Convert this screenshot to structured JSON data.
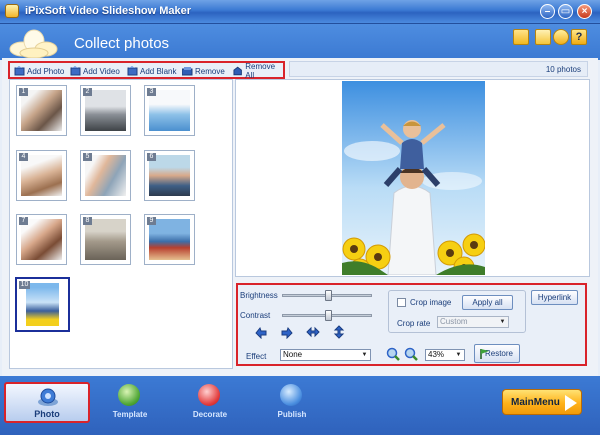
{
  "window": {
    "title": "iPixSoft Video Slideshow Maker"
  },
  "header": {
    "title": "Collect photos"
  },
  "toolbar": {
    "add_photo": "Add Photo",
    "add_video": "Add Video",
    "add_blank": "Add Blank",
    "remove": "Remove",
    "remove_all": "Remove All"
  },
  "photo_count": "10 photos",
  "thumbnails": [
    "1",
    "2",
    "3",
    "4",
    "5",
    "6",
    "7",
    "8",
    "9",
    "10"
  ],
  "selected_thumbnail": "10",
  "controls": {
    "brightness_label": "Brightness",
    "brightness_value": 0.5,
    "contrast_label": "Contrast",
    "contrast_value": 0.5,
    "effect_label": "Effect",
    "effect_value": "None",
    "crop_image_label": "Crop image",
    "crop_image_checked": false,
    "apply_all_label": "Apply all",
    "crop_rate_label": "Crop rate",
    "crop_rate_value": "Custom",
    "hyperlink_label": "Hyperlink",
    "zoom_value": "43%",
    "restore_label": "Restore"
  },
  "nav": {
    "photo": "Photo",
    "template": "Template",
    "decorate": "Decorate",
    "publish": "Publish",
    "main_menu": "MainMenu"
  },
  "colors": {
    "accent": "#3b79d2",
    "highlight": "#d9232a",
    "mainmenu": "#ffb21a"
  }
}
